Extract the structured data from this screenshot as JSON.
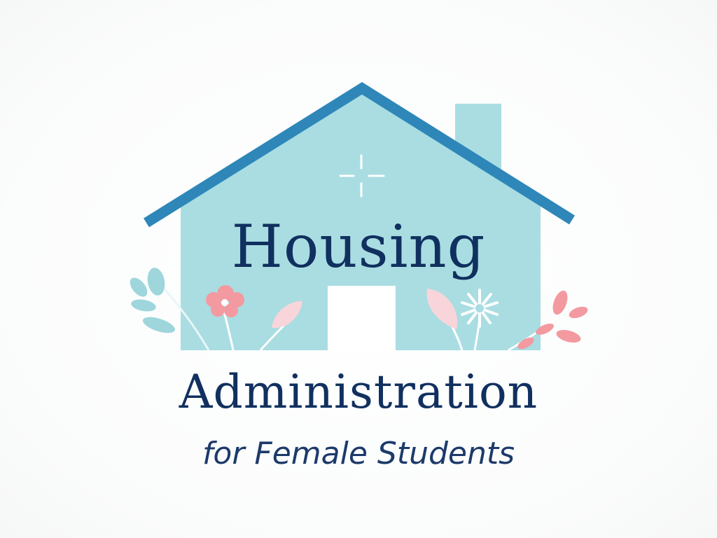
{
  "logo": {
    "title_line1": "Housing",
    "title_line2": "Administration",
    "subtitle": "for Female Students",
    "icons": [
      "house-icon",
      "roof-icon",
      "chimney-icon",
      "sparkle-icon",
      "door-icon",
      "leaf-sprig-icon",
      "flower-icon",
      "leaf-icon",
      "daisy-icon"
    ],
    "colors": {
      "house": "#a9dde2",
      "roof": "#2e87b8",
      "text": "#10305f",
      "pink": "#f39aa0",
      "light_pink": "#f8d5da",
      "teal_leaf": "#9ed6dc"
    }
  }
}
